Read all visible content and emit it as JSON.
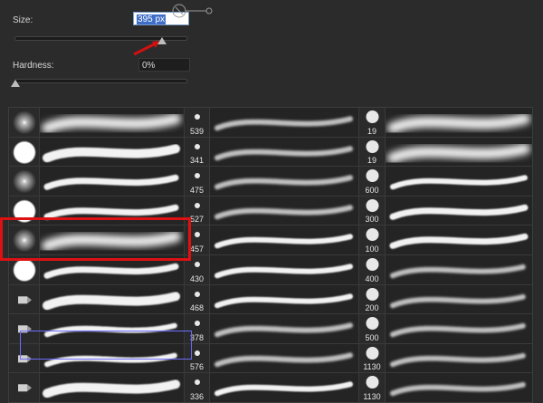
{
  "size": {
    "label": "Size:",
    "value": "395 px",
    "level": 0.85
  },
  "hardness": {
    "label": "Hardness:",
    "value": "0%",
    "level": 0.0
  },
  "colors": {
    "annotation_red": "#d11111",
    "selection_blue": "#6c6cff",
    "text_highlight": "#3f6ec9"
  },
  "brushes": {
    "col1": [
      {
        "thumb": "soft-round",
        "name": "soft-round-brush"
      },
      {
        "thumb": "hard-round",
        "name": "hard-round-brush"
      },
      {
        "thumb": "soft-round",
        "name": "soft-round-pressure-brush"
      },
      {
        "thumb": "hard-round",
        "name": "hard-round-pressure-brush"
      },
      {
        "thumb": "soft-round",
        "name": "soft-round-selected-brush"
      },
      {
        "thumb": "hard-round",
        "name": "hard-round-pressure-opacity-brush"
      },
      {
        "thumb": "tip",
        "name": "flat-tip-brush"
      },
      {
        "thumb": "tip",
        "name": "bristle-brush"
      },
      {
        "thumb": "tip",
        "name": "bristle-wide-brush"
      },
      {
        "thumb": "tip",
        "name": "flat-wide-brush"
      }
    ],
    "col2": [
      "539",
      "341",
      "475",
      "527",
      "457",
      "430",
      "468",
      "378",
      "576",
      "336"
    ],
    "col3": [
      "19",
      "19",
      "600",
      "300",
      "100",
      "400",
      "200",
      "500",
      "1130",
      "1130"
    ]
  }
}
